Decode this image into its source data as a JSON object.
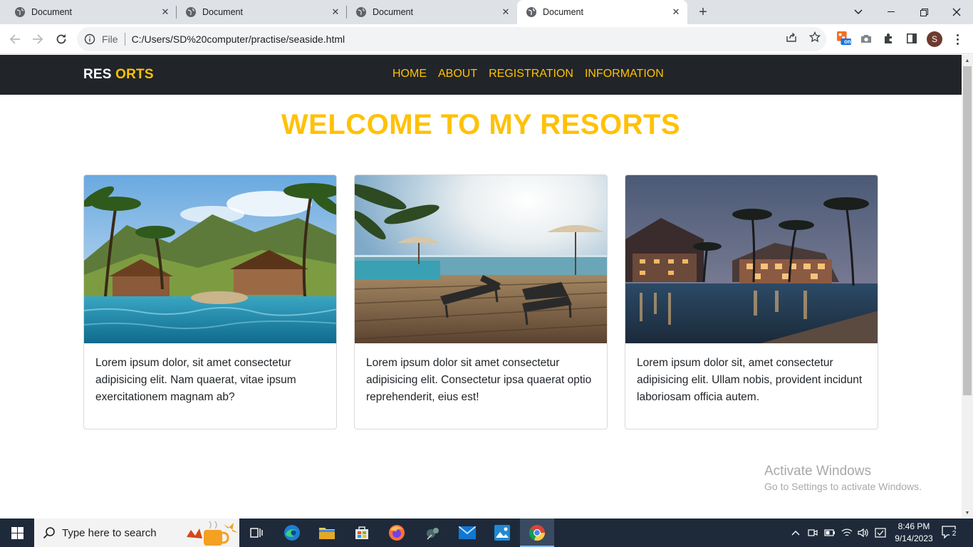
{
  "browser": {
    "tabs": [
      {
        "title": "Document",
        "active": false
      },
      {
        "title": "Document",
        "active": false
      },
      {
        "title": "Document",
        "active": false
      },
      {
        "title": "Document",
        "active": true
      }
    ],
    "address_prefix": "File",
    "address_url": "C:/Users/SD%20computer/practise/seaside.html",
    "avatar_letter": "S",
    "ext_badge": "on"
  },
  "site": {
    "brand_white": "RES",
    "brand_accent": "ORTS",
    "nav": [
      "HOME",
      "ABOUT",
      "REGISTRATION",
      "INFORMATION"
    ],
    "hero_title": "WELCOME TO MY RESORTS",
    "cards": [
      {
        "text": "Lorem ipsum dolor, sit amet consectetur adipisicing elit. Nam quaerat, vitae ipsum exercitationem magnam ab?",
        "image": "tropical-pool-palms-photo"
      },
      {
        "text": "Lorem ipsum dolor sit amet consectetur adipisicing elit. Consectetur ipsa quaerat optio reprehenderit, eius est!",
        "image": "sunlounger-deck-sea-photo"
      },
      {
        "text": "Lorem ipsum dolor sit, amet consectetur adipisicing elit. Ullam nobis, provident incidunt laboriosam officia autem.",
        "image": "resort-night-pool-photo"
      }
    ],
    "accent_color": "#ffc107",
    "nav_bg": "#212529"
  },
  "watermark": {
    "line1": "Activate Windows",
    "line2": "Go to Settings to activate Windows."
  },
  "taskbar": {
    "search_placeholder": "Type here to search",
    "time": "8:46 PM",
    "date": "9/14/2023",
    "notification_count": "2"
  }
}
